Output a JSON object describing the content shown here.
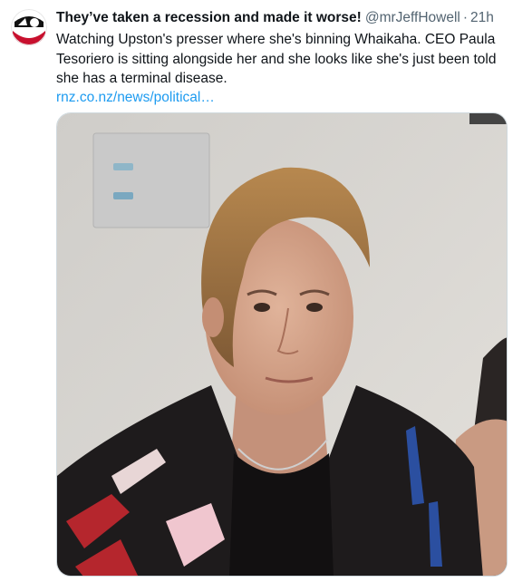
{
  "tweet": {
    "display_name": "They’ve taken a recession and made it worse!",
    "handle": "@mrJeffHowell",
    "separator": "·",
    "time": "21h",
    "text": "Watching Upston's presser where she's binning Whaikaha. CEO Paula Tesoriero is sitting alongside her and she looks like she's just been told she has a terminal disease.",
    "link_text": "rnz.co.nz/news/political…"
  },
  "avatar": {
    "icon": "avatar-logo-icon",
    "colors": [
      "#c8102e",
      "#000000",
      "#ffffff"
    ]
  },
  "media": {
    "icon": "photo-image",
    "description_colors": {
      "wall": "#d9d6d0",
      "hair": "#a77a47",
      "skin": "#d9a98e",
      "jacket": "#1f1c1d"
    }
  },
  "colors": {
    "text": "#0f1419",
    "secondary": "#536471",
    "link": "#1d9bf0",
    "border": "#cfd9de"
  }
}
